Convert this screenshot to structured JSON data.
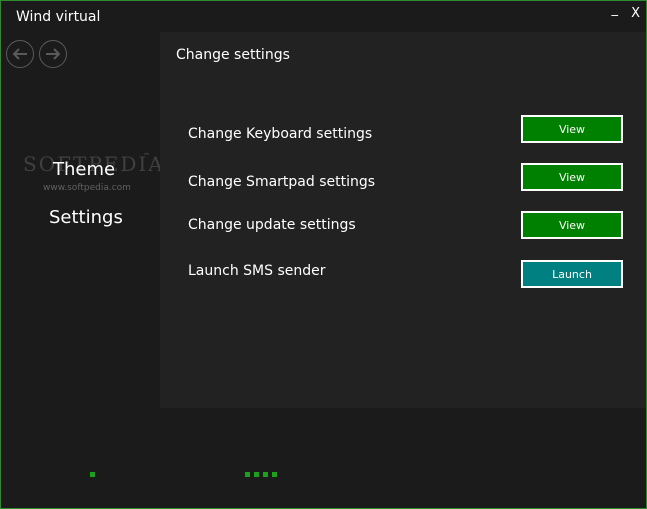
{
  "window": {
    "title": "Wind virtual",
    "minimize_glyph": "_",
    "close_glyph": "X"
  },
  "nav": {
    "back_icon": "arrow-left-icon",
    "forward_icon": "arrow-right-icon"
  },
  "watermark": {
    "brand": "SOFTPEDIA",
    "tm": "™",
    "url": "www.softpedia.com"
  },
  "sidebar": {
    "items": [
      {
        "label": "Theme"
      },
      {
        "label": "Settings"
      }
    ]
  },
  "panel": {
    "title": "Change settings",
    "rows": [
      {
        "label": "Change Keyboard settings",
        "button": "View"
      },
      {
        "label": "Change Smartpad settings",
        "button": "View"
      },
      {
        "label": "Change update settings",
        "button": "View"
      },
      {
        "label": "Launch SMS sender",
        "button": "Launch"
      }
    ]
  },
  "colors": {
    "accent_green": "#008000",
    "accent_teal": "#008080",
    "border": "#2e8b2e",
    "indicator_dot": "#1aa31a"
  }
}
